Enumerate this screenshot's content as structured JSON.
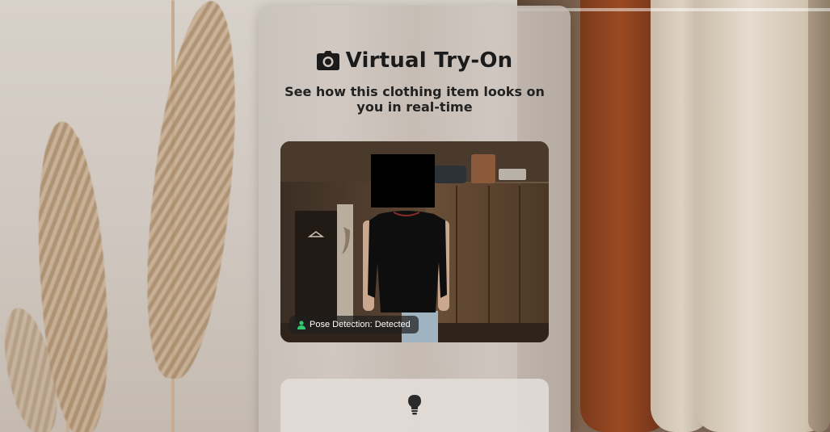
{
  "header": {
    "title": "Virtual Try-On",
    "subtitle": "See how this clothing item looks on you in real-time",
    "title_icon": "camera-icon"
  },
  "camera": {
    "pose_status_label": "Pose Detection: Detected",
    "pose_status_icon": "person-icon",
    "pose_status_color": "#2ecc71",
    "overlay_garment": "black long-sleeve top"
  },
  "tips": {
    "icon": "lightbulb-icon"
  }
}
